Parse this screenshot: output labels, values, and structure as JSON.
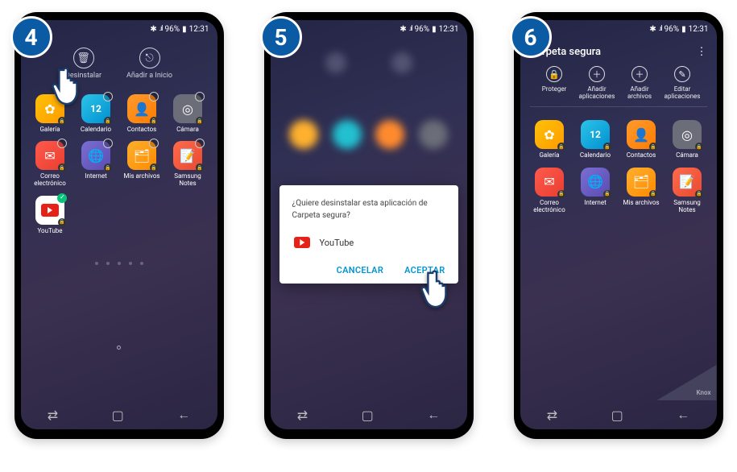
{
  "steps": [
    "4",
    "5",
    "6"
  ],
  "status": {
    "battery": "96%",
    "time": "12:31",
    "bt": "✱",
    "net": "⁴ᴳ",
    "sig": ".ıl",
    "batt_icon": "▮"
  },
  "step4": {
    "actions": {
      "uninstall": "Desinstalar",
      "addhome": "Añadir a Inicio"
    },
    "apps": [
      {
        "name": "Galería",
        "cls": "gallery",
        "glyph": "✿"
      },
      {
        "name": "Calendario",
        "cls": "calendar",
        "glyph": "12"
      },
      {
        "name": "Contactos",
        "cls": "contacts",
        "glyph": "👤"
      },
      {
        "name": "Cámara",
        "cls": "camera",
        "glyph": "◎"
      },
      {
        "name": "Correo electrónico",
        "cls": "mail",
        "glyph": "✉"
      },
      {
        "name": "Internet",
        "cls": "internet",
        "glyph": "🌐"
      },
      {
        "name": "Mis archivos",
        "cls": "files",
        "glyph": "🗂"
      },
      {
        "name": "Samsung Notes",
        "cls": "notes",
        "glyph": "📝"
      },
      {
        "name": "YouTube",
        "cls": "white",
        "glyph": "▶",
        "checked": true
      }
    ]
  },
  "step5": {
    "dialog": {
      "message": "¿Quiere desinstalar esta aplicación de Carpeta segura?",
      "app": "YouTube",
      "cancel": "CANCELAR",
      "accept": "ACEPTAR"
    }
  },
  "step6": {
    "title": "Carpeta segura",
    "tools": [
      {
        "label": "Proteger",
        "glyph": "🔒"
      },
      {
        "label": "Añadir aplicaciones",
        "glyph": "＋"
      },
      {
        "label": "Añadir archivos",
        "glyph": "＋"
      },
      {
        "label": "Editar aplicaciones",
        "glyph": "✎"
      }
    ],
    "apps": [
      {
        "name": "Galería",
        "cls": "gallery",
        "glyph": "✿"
      },
      {
        "name": "Calendario",
        "cls": "calendar",
        "glyph": "12"
      },
      {
        "name": "Contactos",
        "cls": "contacts",
        "glyph": "👤"
      },
      {
        "name": "Cámara",
        "cls": "camera",
        "glyph": "◎"
      },
      {
        "name": "Correo electrónico",
        "cls": "mail",
        "glyph": "✉"
      },
      {
        "name": "Internet",
        "cls": "internet",
        "glyph": "🌐"
      },
      {
        "name": "Mis archivos",
        "cls": "files",
        "glyph": "🗂"
      },
      {
        "name": "Samsung Notes",
        "cls": "notes",
        "glyph": "📝"
      }
    ],
    "knox": "Knox"
  }
}
